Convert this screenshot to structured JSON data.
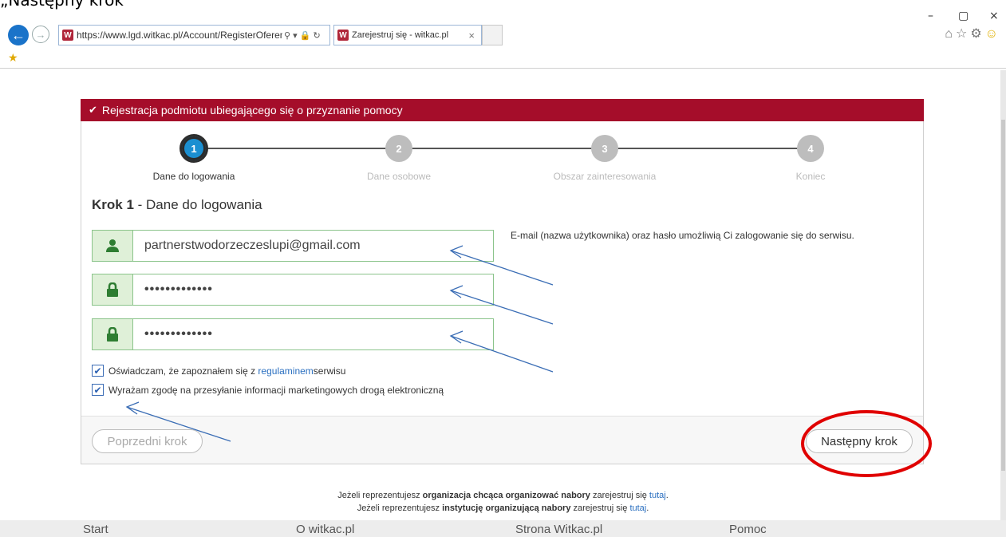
{
  "caption": "„Następny krok\"",
  "window": {
    "minimize": "–",
    "maximize": "▢",
    "close": "×"
  },
  "browser": {
    "url": "https://www.lgd.witkac.pl/Account/RegisterOferent",
    "url_icons": "⚲ ▾ 🔒 ↻",
    "tab_title": "Zarejestruj się - witkac.pl",
    "tab_close": "×",
    "favicon_letter": "W"
  },
  "card": {
    "header": "Rejestracja podmiotu ubiegającego się o przyznanie pomocy",
    "steps": [
      {
        "num": "1",
        "label": "Dane do logowania"
      },
      {
        "num": "2",
        "label": "Dane osobowe"
      },
      {
        "num": "3",
        "label": "Obszar zainteresowania"
      },
      {
        "num": "4",
        "label": "Koniec"
      }
    ],
    "section_title_bold": "Krok 1",
    "section_title_rest": " - Dane do logowania",
    "email_value": "partnerstwodorzeczeslupi@gmail.com",
    "password_value": "•••••••••••••",
    "password_repeat_value": "•••••••••••••",
    "info_text": "E-mail (nazwa użytkownika) oraz hasło umożliwią Ci zalogowanie się do serwisu.",
    "checkbox1_before": "Oświadczam, że zapoznałem się z ",
    "checkbox1_link": "regulaminem",
    "checkbox1_after": " serwisu",
    "checkbox2": "Wyrażam zgodę na przesyłanie informacji marketingowych drogą elektroniczną",
    "prev_button": "Poprzedni krok",
    "next_button": "Następny krok"
  },
  "bottom": {
    "line1_a": "Jeżeli reprezentujesz ",
    "line1_b": "organizacja chcąca organizować nabory",
    "line1_c": " zarejestruj się ",
    "line1_link": "tutaj",
    "line2_a": "Jeżeli reprezentujesz ",
    "line2_b": "instytucję organizującą nabory",
    "line2_c": " zarejestruj się ",
    "line2_link": "tutaj",
    "period": "."
  },
  "nav": [
    "Start",
    "O witkac.pl",
    "Strona Witkac.pl",
    "Pomoc"
  ],
  "colors": {
    "header": "#a50d2a",
    "active_step": "#1b8fd1",
    "annotation_arrow": "#3a6db5",
    "annotation_circle": "#e00000"
  }
}
